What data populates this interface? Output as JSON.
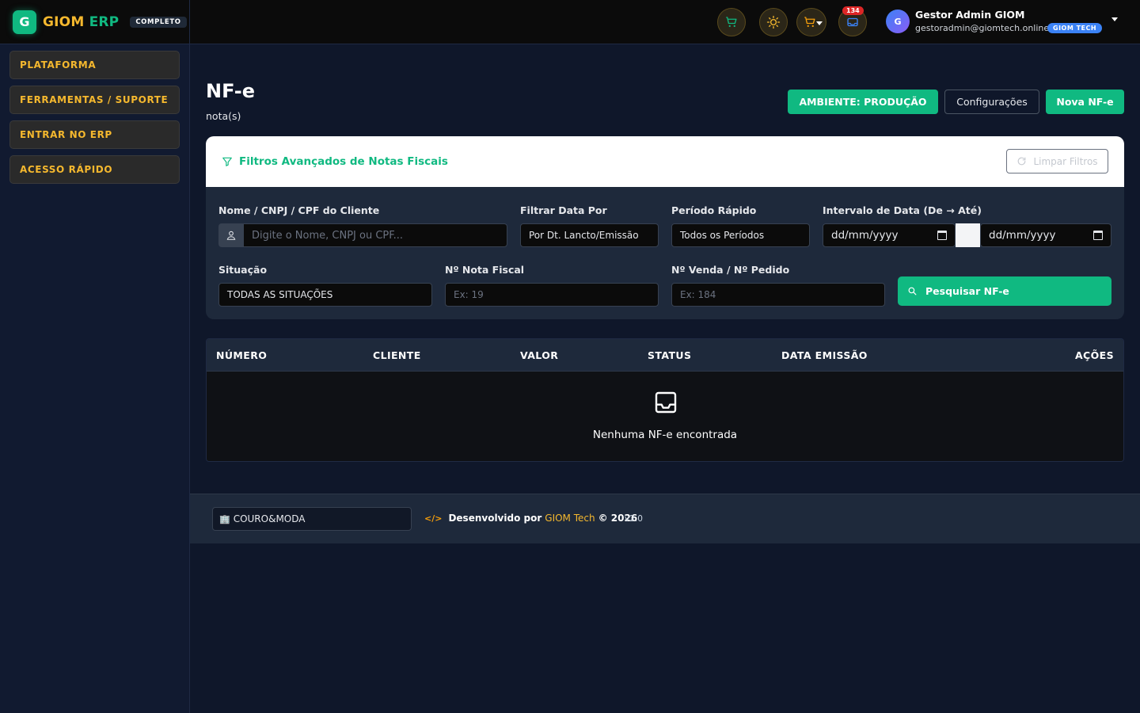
{
  "brand": {
    "logo_letter": "G",
    "name_main": "GIOM",
    "name_accent": "ERP",
    "badge": "COMPLETO"
  },
  "sidebar": {
    "items": [
      {
        "label": "PLATAFORMA"
      },
      {
        "label": "FERRAMENTAS / SUPORTE"
      },
      {
        "label": "ENTRAR NO ERP"
      },
      {
        "label": "ACESSO RÁPIDO"
      }
    ]
  },
  "topbar": {
    "notification_count": "134",
    "user": {
      "initial": "G",
      "name": "Gestor Admin GIOM",
      "email": "gestoradmin@giomtech.online",
      "org_tag": "GIOM TECH"
    }
  },
  "page": {
    "title": "NF-e",
    "subtitle": "nota(s)",
    "env_button": "AMBIENTE: PRODUÇÃO",
    "config_button": "Configurações",
    "new_button": "Nova NF-e"
  },
  "filters": {
    "title": "Filtros Avançados de Notas Fiscais",
    "clear_button": "Limpar Filtros",
    "client": {
      "label": "Nome / CNPJ / CPF do Cliente",
      "placeholder": "Digite o Nome, CNPJ ou CPF..."
    },
    "date_by": {
      "label": "Filtrar Data Por",
      "value": "Por Dt. Lancto/Emissão"
    },
    "period": {
      "label": "Período Rápido",
      "value": "Todos os Períodos"
    },
    "interval": {
      "label": "Intervalo de Data (De → Até)",
      "from_placeholder": "dd/mm/yyyy",
      "to_placeholder": "dd/mm/yyyy"
    },
    "status": {
      "label": "Situação",
      "value": "TODAS AS SITUAÇÕES"
    },
    "invoice_no": {
      "label": "Nº Nota Fiscal",
      "placeholder": "Ex: 19"
    },
    "order_no": {
      "label": "Nº Venda / Nº Pedido",
      "placeholder": "Ex: 184"
    },
    "search_button": "Pesquisar NF-e"
  },
  "table": {
    "columns": [
      "NÚMERO",
      "CLIENTE",
      "VALOR",
      "STATUS",
      "DATA EMISSÃO",
      "AÇÕES"
    ],
    "empty_text": "Nenhuma NF-e encontrada"
  },
  "footer": {
    "company": "COURO&MODA",
    "dev_prefix": "Desenvolvido por",
    "dev_brand": "GIOM Tech",
    "dev_year": "© 2026",
    "version": "v2.0"
  },
  "colors": {
    "accent": "#10b981",
    "brand_gold": "#f5b82e",
    "badge_red": "#dc2626",
    "tag_blue": "#3b82f6"
  }
}
